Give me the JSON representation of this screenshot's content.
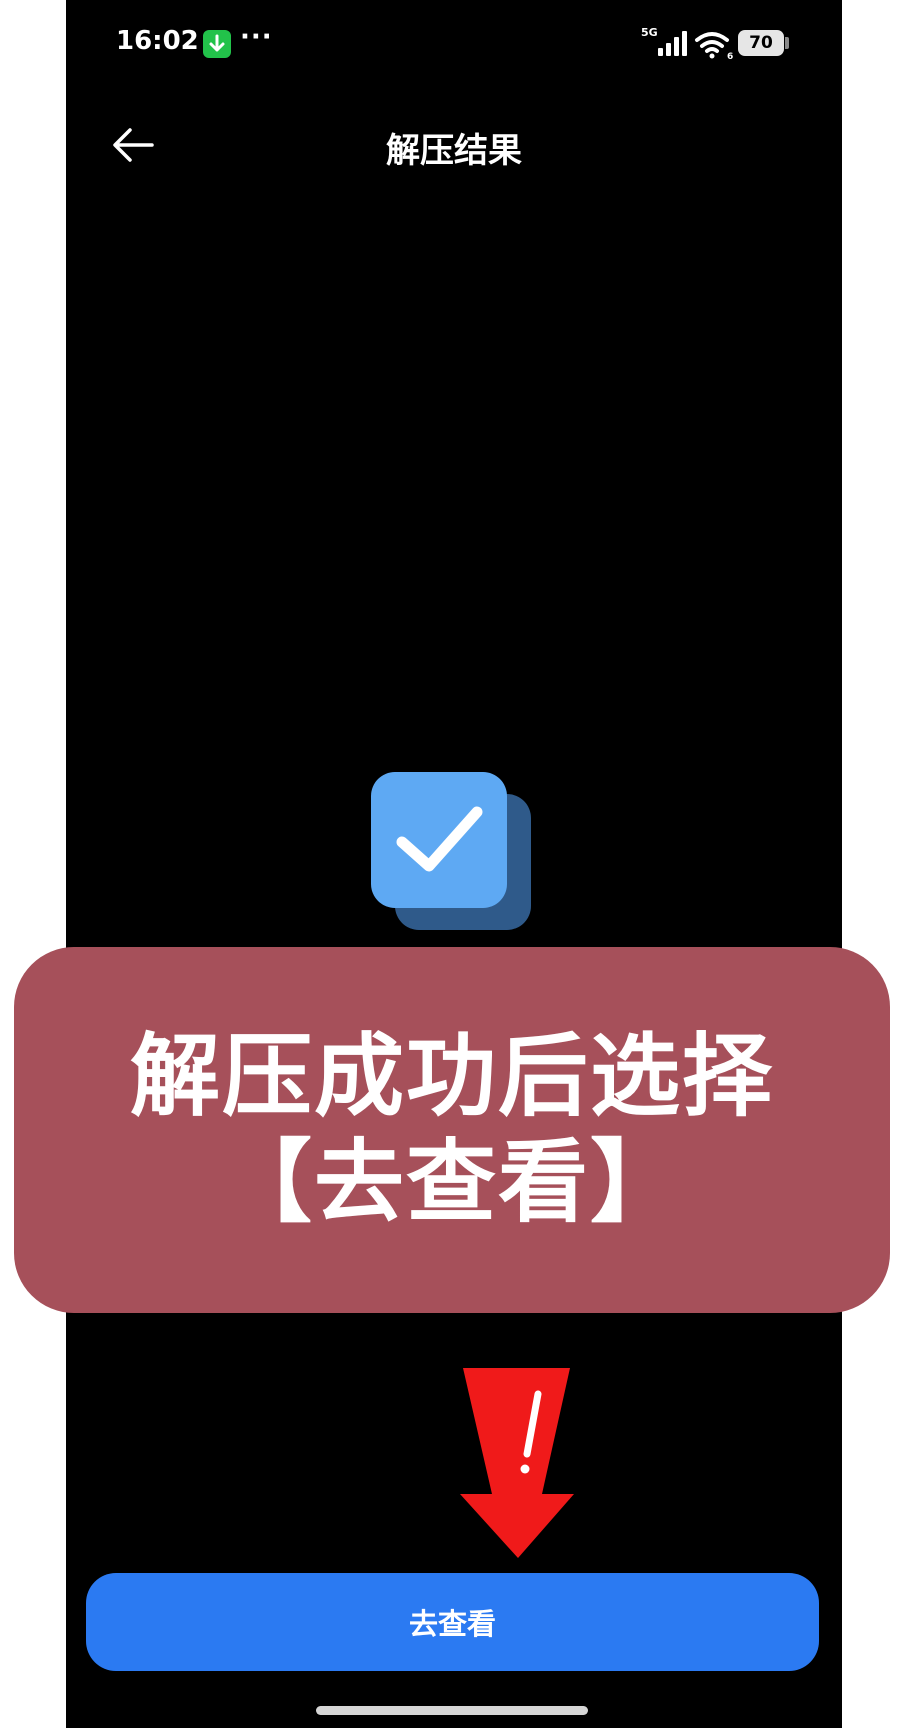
{
  "status_bar": {
    "time": "16:02",
    "more_indicator": "···",
    "network_label": "5G",
    "wifi_sub": "6",
    "battery_level": "70"
  },
  "header": {
    "title": "解压结果",
    "back_icon": "arrow-left-icon"
  },
  "result": {
    "icon": "checkmark-success-icon"
  },
  "caption": {
    "line1": "解压成功后选择",
    "line2": "【去查看】"
  },
  "annotation": {
    "icon": "red-arrow-down-icon"
  },
  "actions": {
    "view_button_label": "去查看"
  },
  "colors": {
    "background": "#000000",
    "accent": "#2b7af2",
    "check_front": "#5ea9f3",
    "check_back": "#2f5a8a",
    "caption_bg": "#a6505a",
    "arrow_red": "#f01a1a",
    "download_badge": "#22c24a"
  }
}
